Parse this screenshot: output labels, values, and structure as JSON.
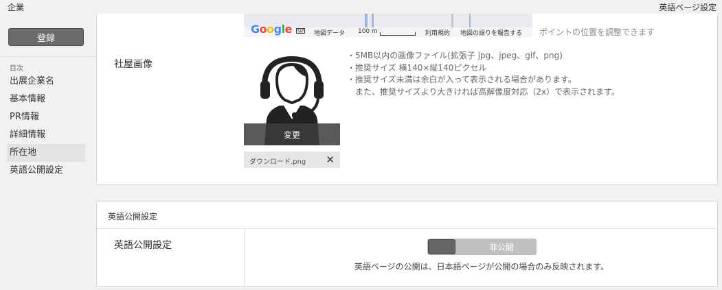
{
  "topbar": {
    "title_left": "企業",
    "title_right": "英語ページ設定"
  },
  "sidebar": {
    "register_label": "登録",
    "toc_heading": "目次",
    "items": [
      {
        "label": "出展企業名"
      },
      {
        "label": "基本情報"
      },
      {
        "label": "PR情報"
      },
      {
        "label": "詳細情報"
      },
      {
        "label": "所在地"
      },
      {
        "label": "英語公開設定"
      }
    ],
    "active_item": "所在地"
  },
  "map": {
    "logo": "Google",
    "map_data": "地図データ",
    "scale": "100 m",
    "terms": "利用規約",
    "report": "地図の誤りを報告する",
    "hint": "ポイントの位置を調整できます"
  },
  "photo": {
    "label": "社屋画像",
    "change_label": "変更",
    "file_name": "ダウンロード.png",
    "remove_glyph": "✕",
    "notes": [
      "・5MB以内の画像ファイル(拡張子 jpg、jpeg、gif、png)",
      "・推奨サイズ 横140×縦140ピクセル",
      "・推奨サイズ未満は余白が入って表示される場合があります。",
      "　また、推奨サイズより大きければ高解像度対応（2x）で表示されます。"
    ]
  },
  "english": {
    "section_title": "英語公開設定",
    "row_label": "英語公開設定",
    "toggle_label": "非公開",
    "note": "英語ページの公開は、日本語ページが公開の場合のみ反映されます。"
  },
  "colors": {
    "sidebar_bg": "#f1f1f1",
    "register_button": "#6b6b6b",
    "active_item_bg": "#e3e3e3",
    "toggle_track": "#c0c0c0",
    "toggle_knob": "#666666"
  },
  "icons": {
    "avatar": "headset-person-icon",
    "remove": "close-icon",
    "keyboard": "keyboard-icon"
  }
}
